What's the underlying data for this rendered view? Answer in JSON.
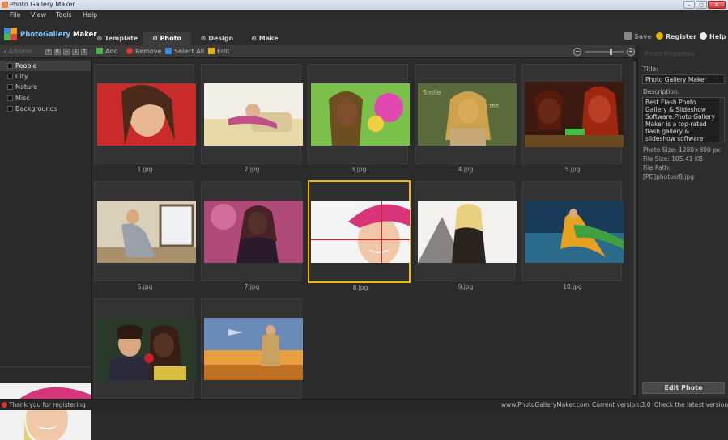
{
  "window": {
    "title": "Photo Gallery Maker",
    "controls": {
      "minimize": "–",
      "maximize": "◻",
      "close": "✕"
    }
  },
  "menu": [
    "File",
    "View",
    "Tools",
    "Help"
  ],
  "header": {
    "logo_part1": "PhotoGallery",
    "logo_part2": "Maker",
    "tabs": [
      {
        "label": "Template",
        "icon": "template-icon"
      },
      {
        "label": "Photo",
        "icon": "photo-icon",
        "active": true
      },
      {
        "label": "Design",
        "icon": "design-icon"
      },
      {
        "label": "Make",
        "icon": "make-icon"
      }
    ],
    "actions": [
      {
        "label": "Save",
        "icon": "save-icon",
        "enabled": false
      },
      {
        "label": "Register",
        "icon": "register-icon",
        "enabled": true
      },
      {
        "label": "Help",
        "icon": "help-icon",
        "enabled": true
      }
    ]
  },
  "toolbar": {
    "albums_label": "Albums",
    "mini_buttons": [
      "+",
      "R",
      "−",
      "↓",
      "↑"
    ],
    "add": "Add",
    "remove": "Remove",
    "select_all": "Select All",
    "edit": "Edit",
    "zoom_minus": "−",
    "zoom_plus": "+"
  },
  "albums": [
    {
      "label": "People",
      "selected": true
    },
    {
      "label": "City"
    },
    {
      "label": "Nature"
    },
    {
      "label": "Misc"
    },
    {
      "label": "Backgrounds"
    }
  ],
  "photos": [
    {
      "name": "1.jpg"
    },
    {
      "name": "2.jpg"
    },
    {
      "name": "3.jpg"
    },
    {
      "name": "4.jpg"
    },
    {
      "name": "5.jpg"
    },
    {
      "name": "6.jpg"
    },
    {
      "name": "7.jpg"
    },
    {
      "name": "8.jpg",
      "selected": true,
      "focus": "Focus:71%,61%"
    },
    {
      "name": "9.jpg"
    },
    {
      "name": "10.jpg"
    },
    {
      "name": ""
    },
    {
      "name": ""
    }
  ],
  "properties": {
    "hidden_title": "Photo Properties",
    "title_label": "Title:",
    "title_value": "Photo Gallery Maker",
    "description_label": "Description:",
    "description_value": "Best Flash Photo Gallery & Slideshow Software.Photo Gallery Maker is a top-rated flash gallery & slideshow software that helps you create photo",
    "photo_size": "Photo Size:  1280×800 px",
    "file_size": "File Size:  105.41 KB",
    "file_path_label": "File Path:",
    "file_path": "[PD]photos/8.jpg",
    "edit_button": "Edit Photo"
  },
  "status": {
    "message": "Thank you for registering",
    "site": "www.PhotoGalleryMaker.com",
    "version": "Current version:3.0",
    "check": "Check the latest version"
  },
  "colors": {
    "accent_selection": "#f5b800",
    "focus_line": "#e02020",
    "logo_blue": "#7fc4ff"
  }
}
